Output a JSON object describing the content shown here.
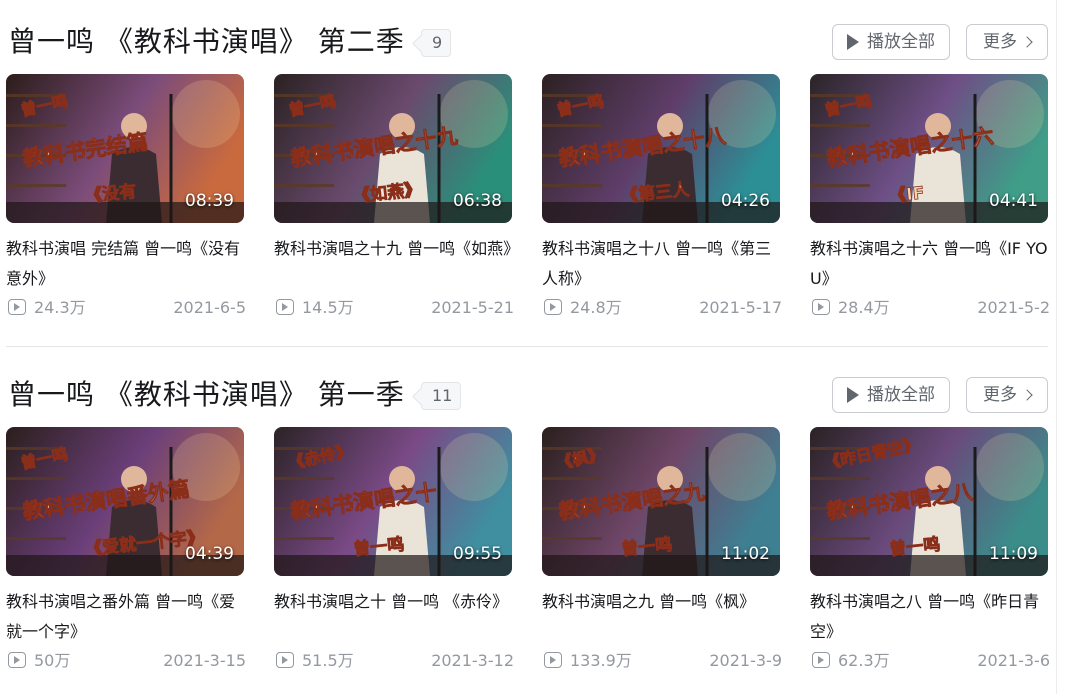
{
  "sections": [
    {
      "title": "曾一鸣 《教科书演唱》 第二季",
      "count": "9",
      "play_all": "播放全部",
      "more": "更多",
      "videos": [
        {
          "title": "教科书演唱 完结篇 曾一鸣《没有意外》",
          "duration": "08:39",
          "views": "24.3万",
          "date": "2021-6-5",
          "overlay": [
            "曾一鸣",
            "教科书完结篇",
            "《没有"
          ],
          "colors": [
            "#2b1d1a",
            "#7b4c7a",
            "#c96a3e"
          ]
        },
        {
          "title": "教科书演唱之十九 曾一鸣《如燕》",
          "duration": "06:38",
          "views": "14.5万",
          "date": "2021-5-21",
          "overlay": [
            "曾一鸣",
            "教科书演唱之十九",
            "《如燕》"
          ],
          "colors": [
            "#2a2222",
            "#6a4a6e",
            "#2a8f7a"
          ]
        },
        {
          "title": "教科书演唱之十八 曾一鸣《第三人称》",
          "duration": "04:26",
          "views": "24.8万",
          "date": "2021-5-17",
          "overlay": [
            "曾一鸣",
            "教科书演唱之十八",
            "《第三人"
          ],
          "colors": [
            "#2c2121",
            "#5f3e6a",
            "#2c8f96"
          ]
        },
        {
          "title": "教科书演唱之十六 曾一鸣《IF YOU》",
          "duration": "04:41",
          "views": "28.4万",
          "date": "2021-5-2",
          "overlay": [
            "曾一鸣",
            "教科书演唱之十六",
            "《IF"
          ],
          "colors": [
            "#2a2426",
            "#6e4f86",
            "#3f9d88"
          ]
        }
      ]
    },
    {
      "title": "曾一鸣 《教科书演唱》 第一季",
      "count": "11",
      "play_all": "播放全部",
      "more": "更多",
      "videos": [
        {
          "title": "教科书演唱之番外篇 曾一鸣《爱就一个字》",
          "duration": "04:39",
          "views": "50万",
          "date": "2021-3-15",
          "overlay": [
            "曾一鸣",
            "教科书演唱番外篇",
            "《爱就一个字》"
          ],
          "colors": [
            "#2b1f1c",
            "#6b3f7a",
            "#b36848"
          ]
        },
        {
          "title": "教科书演唱之十 曾一鸣 《赤伶》",
          "duration": "09:55",
          "views": "51.5万",
          "date": "2021-3-12",
          "overlay": [
            "《赤伶》",
            "教科书演唱之十",
            "曾一鸣"
          ],
          "colors": [
            "#2b2326",
            "#7a4a86",
            "#3f8fa0"
          ]
        },
        {
          "title": "教科书演唱之九 曾一鸣《枫》",
          "duration": "11:02",
          "views": "133.9万",
          "date": "2021-3-9",
          "overlay": [
            "《枫》",
            "教科书演唱之九",
            "曾一鸣"
          ],
          "colors": [
            "#2a201e",
            "#6f4668",
            "#3f7f92"
          ]
        },
        {
          "title": "教科书演唱之八 曾一鸣《昨日青空》",
          "duration": "11:09",
          "views": "62.3万",
          "date": "2021-3-6",
          "overlay": [
            "《昨日青空》",
            "教科书演唱之八",
            "曾一鸣"
          ],
          "colors": [
            "#2a2224",
            "#6a4a7c",
            "#3b8d8a"
          ]
        }
      ]
    }
  ]
}
